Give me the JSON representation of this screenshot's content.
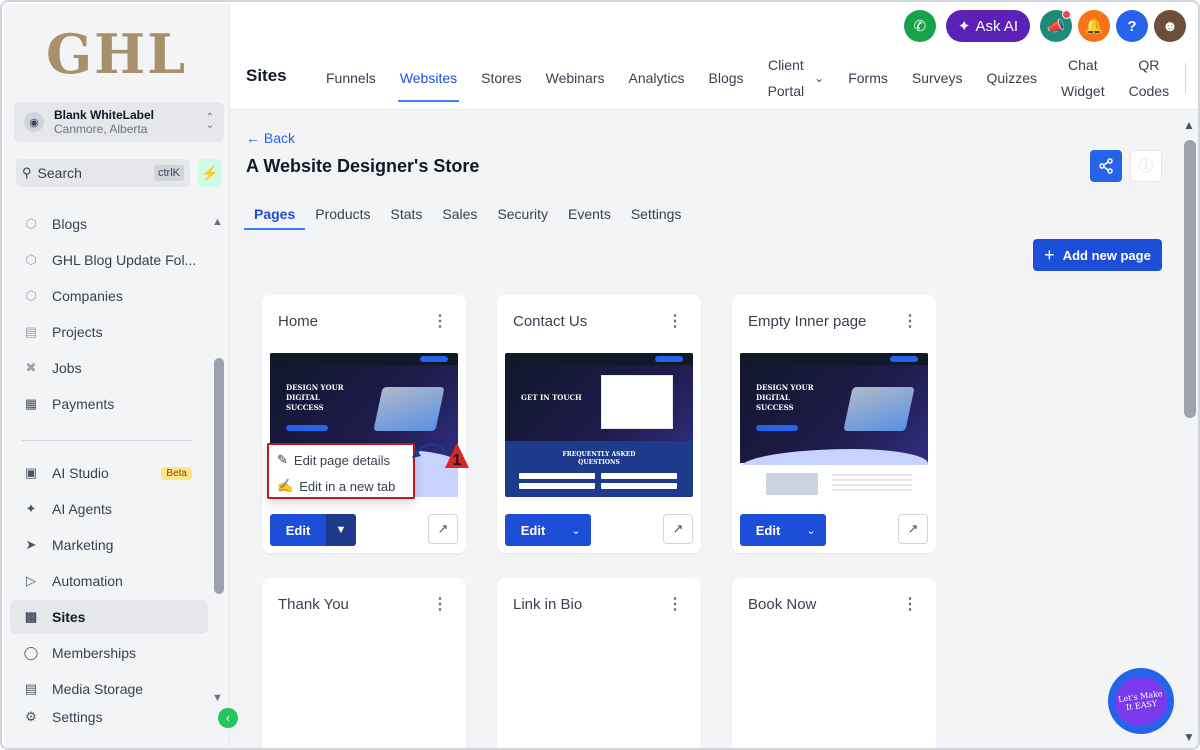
{
  "app": {
    "logo_text": "GHL",
    "location_name": "Blank WhiteLabel",
    "location_sub": "Canmore, Alberta"
  },
  "sidebar": {
    "search_label": "Search",
    "search_shortcut": "ctrlK",
    "items": [
      {
        "label": "Blogs",
        "icon": "cube-icon"
      },
      {
        "label": "GHL Blog Update Fol...",
        "icon": "cube-icon"
      },
      {
        "label": "Companies",
        "icon": "cube-icon"
      },
      {
        "label": "Projects",
        "icon": "clipboard-icon"
      },
      {
        "label": "Jobs",
        "icon": "tools-icon"
      },
      {
        "label": "Payments",
        "icon": "receipt-icon"
      },
      {
        "label": "AI Studio",
        "icon": "ai-studio-icon",
        "badge": "Beta"
      },
      {
        "label": "AI Agents",
        "icon": "sparkle-icon"
      },
      {
        "label": "Marketing",
        "icon": "send-icon"
      },
      {
        "label": "Automation",
        "icon": "automation-icon"
      },
      {
        "label": "Sites",
        "icon": "sites-icon",
        "active": true
      },
      {
        "label": "Memberships",
        "icon": "membership-icon"
      },
      {
        "label": "Media Storage",
        "icon": "image-icon"
      },
      {
        "label": "Settings",
        "icon": "gear-icon"
      }
    ]
  },
  "header": {
    "ask_ai_label": "Ask AI",
    "section_title": "Sites",
    "tabs": [
      {
        "label": "Funnels"
      },
      {
        "label": "Websites",
        "active": true
      },
      {
        "label": "Stores"
      },
      {
        "label": "Webinars"
      },
      {
        "label": "Analytics"
      },
      {
        "label": "Blogs"
      },
      {
        "line1": "Client",
        "line2": "Portal"
      },
      {
        "label": "Forms"
      },
      {
        "label": "Surveys"
      },
      {
        "label": "Quizzes"
      },
      {
        "line1": "Chat",
        "line2": "Widget"
      },
      {
        "line1": "QR",
        "line2": "Codes"
      }
    ]
  },
  "main": {
    "back_label": "← Back",
    "title": "A Website Designer's Store",
    "sub_tabs": [
      "Pages",
      "Products",
      "Stats",
      "Sales",
      "Security",
      "Events",
      "Settings"
    ],
    "active_sub_tab": "Pages",
    "add_page_label": "Add new page",
    "pages": [
      {
        "title": "Home",
        "edit_label": "Edit"
      },
      {
        "title": "Contact Us",
        "edit_label": "Edit"
      },
      {
        "title": "Empty Inner page",
        "edit_label": "Edit"
      },
      {
        "title": "Thank You"
      },
      {
        "title": "Link in Bio"
      },
      {
        "title": "Book Now"
      }
    ],
    "dropdown": {
      "items": [
        "Edit page details",
        "Edit in a new tab"
      ]
    },
    "thumbnail_text": {
      "hero": "DESIGN YOUR\nDIGITAL\nSUCCESS",
      "contact_hero": "GET IN TOUCH",
      "faq": "FREQUENTLY ASKED\nQUESTIONS"
    }
  },
  "annotation": {
    "step_number": "1"
  },
  "fab": {
    "text": "Let's Make It EASY"
  },
  "colors": {
    "primary": "#1d4ed8",
    "accent_purple": "#5b21b6",
    "highlight_red": "#b91c1c",
    "success_green": "#16a34a"
  }
}
